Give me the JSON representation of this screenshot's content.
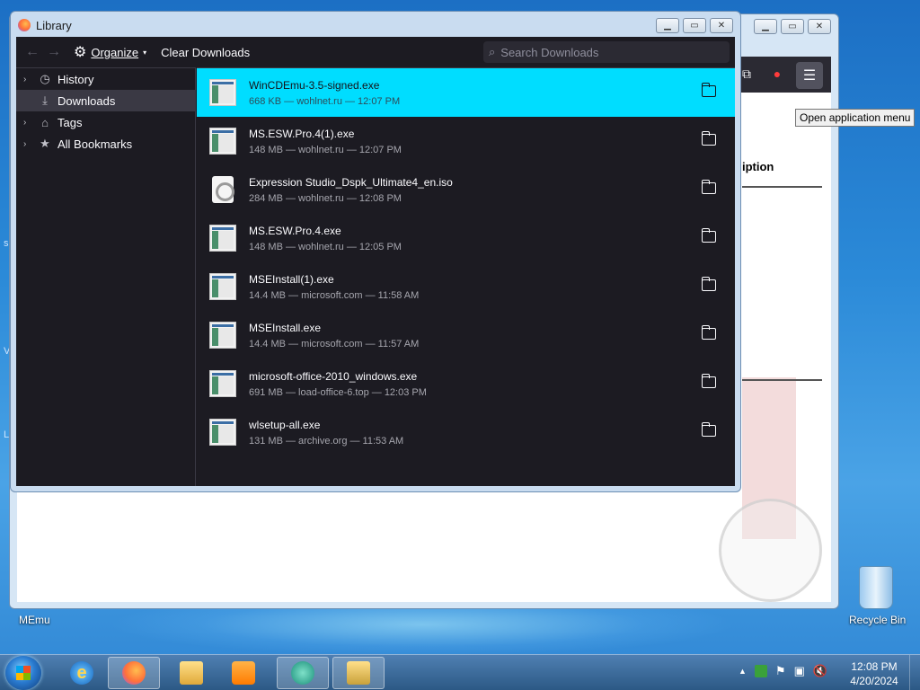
{
  "desktop": {
    "icons": [
      {
        "label": "MEmu"
      },
      {
        "label": "Recycle Bin"
      }
    ]
  },
  "background_window": {
    "tooltip": "Open application menu",
    "heading_fragment": "iption"
  },
  "library": {
    "title": "Library",
    "toolbar": {
      "organize_label": "Organize",
      "clear_label": "Clear Downloads",
      "search_placeholder": "Search Downloads"
    },
    "sidebar": [
      {
        "label": "History",
        "icon": "clock-icon",
        "selected": false
      },
      {
        "label": "Downloads",
        "icon": "download-icon",
        "selected": true
      },
      {
        "label": "Tags",
        "icon": "tag-icon",
        "selected": false
      },
      {
        "label": "All Bookmarks",
        "icon": "star-icon",
        "selected": false
      }
    ],
    "downloads": [
      {
        "name": "WinCDEmu-3.5-signed.exe",
        "meta": "668 KB — wohlnet.ru — 12:07 PM",
        "type": "exe",
        "selected": true
      },
      {
        "name": "MS.ESW.Pro.4(1).exe",
        "meta": "148 MB — wohlnet.ru — 12:07 PM",
        "type": "exe",
        "selected": false
      },
      {
        "name": "Expression Studio_Dspk_Ultimate4_en.iso",
        "meta": "284 MB — wohlnet.ru — 12:08 PM",
        "type": "iso",
        "selected": false
      },
      {
        "name": "MS.ESW.Pro.4.exe",
        "meta": "148 MB — wohlnet.ru — 12:05 PM",
        "type": "exe",
        "selected": false
      },
      {
        "name": "MSEInstall(1).exe",
        "meta": "14.4 MB — microsoft.com — 11:58 AM",
        "type": "exe",
        "selected": false
      },
      {
        "name": "MSEInstall.exe",
        "meta": "14.4 MB — microsoft.com — 11:57 AM",
        "type": "exe",
        "selected": false
      },
      {
        "name": "microsoft-office-2010_windows.exe",
        "meta": "691 MB — load-office-6.top — 12:03 PM",
        "type": "exe",
        "selected": false
      },
      {
        "name": "wlsetup-all.exe",
        "meta": "131 MB — archive.org — 11:53 AM",
        "type": "exe",
        "selected": false
      }
    ]
  },
  "taskbar": {
    "time": "12:08 PM",
    "date": "4/20/2024"
  },
  "colors": {
    "selection": "#00ddff",
    "library_bg": "#1c1b22"
  }
}
